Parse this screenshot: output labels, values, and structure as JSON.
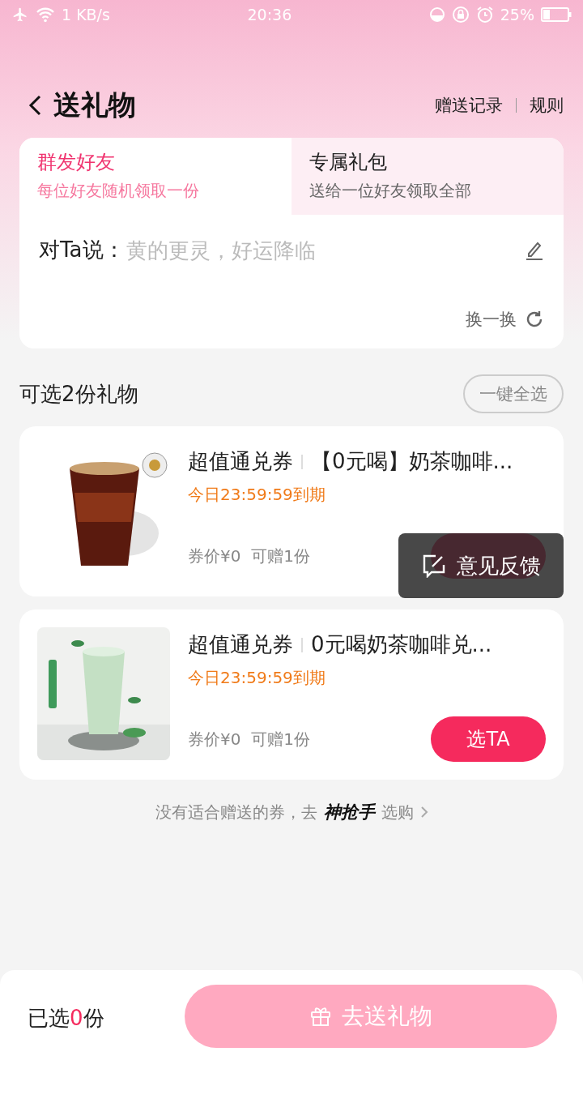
{
  "status_bar": {
    "speed": "1 KB/s",
    "time": "20:36",
    "battery": "25%"
  },
  "header": {
    "title": "送礼物",
    "links": [
      "赠送记录",
      "规则"
    ]
  },
  "tabs": [
    {
      "label": "群发好友",
      "sub": "每位好友随机领取一份",
      "selected": true
    },
    {
      "label": "专属礼包",
      "sub": "送给一位好友领取全部",
      "selected": false
    }
  ],
  "message": {
    "label": "对Ta说：",
    "placeholder": "黄的更灵，好运降临",
    "refresh": "换一换"
  },
  "section": {
    "title": "可选2份礼物",
    "select_all": "一键全选"
  },
  "gifts": [
    {
      "tag": "超值通兑券",
      "name": "【0元喝】奶茶咖啡...",
      "expiry": "今日23:59:59到期",
      "price": "券价¥0",
      "count": "可赠1份",
      "kind": "picture"
    },
    {
      "tag": "超值通兑券",
      "name": "0元喝奶茶咖啡兑...",
      "expiry": "今日23:59:59到期",
      "price": "券价¥0",
      "count": "可赠1份",
      "kind": "picture",
      "button": "选TA"
    }
  ],
  "feedback": {
    "label": "意见反馈"
  },
  "footer_note": {
    "text": "没有适合赠送的券，去",
    "logo": "神抢手",
    "link": "选购"
  },
  "bottom_bar": {
    "prefix": "已选",
    "count": "0",
    "suffix": "份",
    "button": "去送礼物"
  }
}
